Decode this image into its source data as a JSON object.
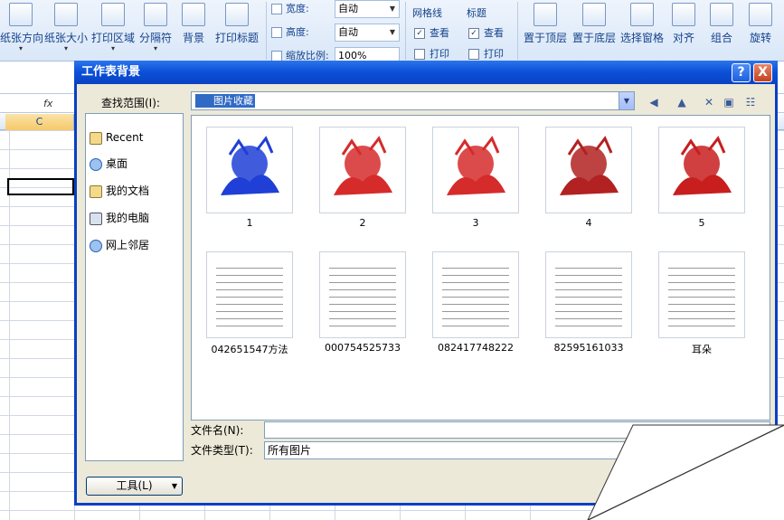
{
  "ribbon": {
    "buttons": [
      "纸张方向",
      "纸张大小",
      "打印区域",
      "分隔符",
      "背景",
      "打印标题"
    ],
    "scale": {
      "width_label": "宽度:",
      "width_value": "自动",
      "height_label": "高度:",
      "height_value": "自动",
      "zoom_label": "缩放比例:",
      "zoom_value": "100%"
    },
    "gridlines": {
      "title": "网格线",
      "view": "查看",
      "print": "打印"
    },
    "headings": {
      "title": "标题",
      "view": "查看",
      "print": "打印"
    },
    "arrange": [
      "置于顶层",
      "置于底层",
      "选择窗格",
      "对齐",
      "组合",
      "旋转"
    ]
  },
  "sheet": {
    "fx": "fx",
    "column": "C"
  },
  "dialog": {
    "title": "工作表背景",
    "help": "?",
    "close": "X",
    "look_in_label": "查找范围(I):",
    "look_in_value": "图片收藏",
    "places": [
      "Recent",
      "桌面",
      "我的文档",
      "我的电脑",
      "网上邻居"
    ],
    "files": [
      {
        "name": "1",
        "color": "#1f3fd6",
        "kind": "art"
      },
      {
        "name": "2",
        "color": "#d62b2b",
        "kind": "art"
      },
      {
        "name": "3",
        "color": "#d62b2b",
        "kind": "art"
      },
      {
        "name": "4",
        "color": "#b22222",
        "kind": "art"
      },
      {
        "name": "5",
        "color": "#c81e1e",
        "kind": "art"
      },
      {
        "name": "042651547方法",
        "kind": "text"
      },
      {
        "name": "000754525733",
        "kind": "text"
      },
      {
        "name": "082417748222",
        "kind": "text"
      },
      {
        "name": "82595161033",
        "kind": "text"
      },
      {
        "name": "耳朵",
        "kind": "text"
      }
    ],
    "filename_label": "文件名(N):",
    "filename_value": "",
    "filetype_label": "文件类型(T):",
    "filetype_value": "所有图片",
    "tools_label": "工具(L)"
  }
}
